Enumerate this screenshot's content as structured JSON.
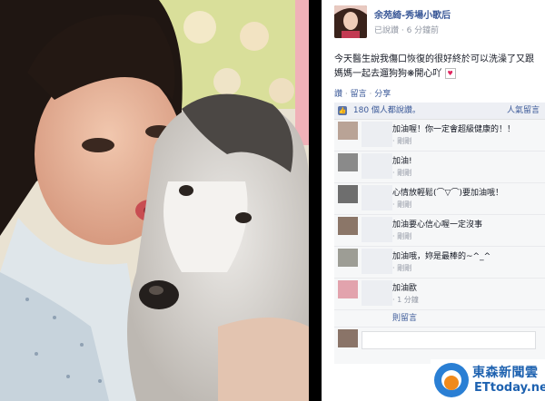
{
  "post": {
    "author": "余苑綺-秀場小歌后",
    "timestamp": "已說讚 · 6 分鐘前",
    "text": "今天醫生說我傷口恢復的很好終於可以洗澡了又跟媽媽一起去遛狗狗❋開心吖",
    "actions": {
      "like": "讚",
      "comment": "留言",
      "share": "分享"
    },
    "likes": "180 個人都說讚。",
    "sort": "人氣留言",
    "more_comments": "則留言"
  },
  "comments": [
    {
      "text": "加油喔！你一定會超級健康的！！",
      "meta": "· 剛剛",
      "avatar_color": "#b9a396"
    },
    {
      "text": "加油!",
      "meta": "· 剛剛",
      "avatar_color": "#8a8a8a"
    },
    {
      "text": "心情放輕鬆(⌒▽⌒)要加油哦！",
      "meta": "· 剛剛",
      "avatar_color": "#6e6e6e"
    },
    {
      "text": "加油要心信心喔一定沒事",
      "meta": "· 剛剛",
      "avatar_color": "#8b7668"
    },
    {
      "text": "加油哦，妳是最棒的~^_^",
      "meta": "· 剛剛",
      "avatar_color": "#9d9d95"
    },
    {
      "text": "加油歐",
      "meta": "· 1 分鐘",
      "avatar_color": "#e2a3ad"
    }
  ],
  "watermark": {
    "cn": "東森新聞雲",
    "en": "ETtoday.net"
  },
  "icons": [
    "thumbs-up-icon",
    "heart-icon",
    "ettoday-logo-icon"
  ]
}
